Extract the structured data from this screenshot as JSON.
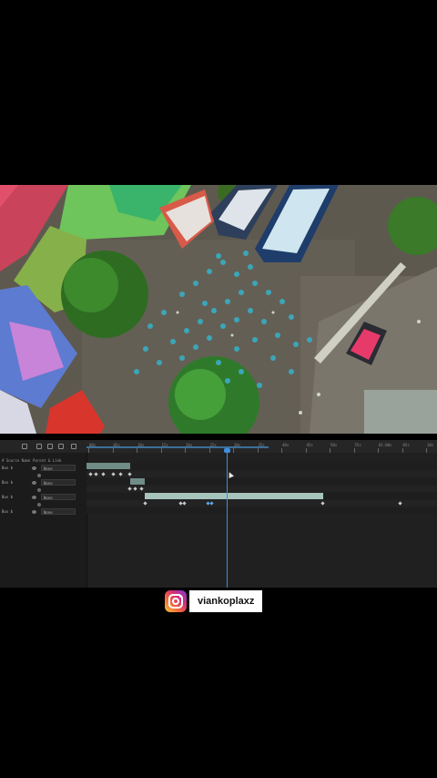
{
  "watermark": {
    "platform_icon": "instagram-icon",
    "handle": "viankoplaxz"
  },
  "timeline": {
    "ruler_labels": [
      "00s",
      "05s",
      "10s",
      "15s",
      "20s",
      "25s",
      "30s",
      "35s",
      "40s",
      "45s",
      "50s",
      "55s",
      "01:00s",
      "05s",
      "10s"
    ],
    "column_headers": {
      "layer_name": "# Source Name",
      "parent": "Parent & Link"
    },
    "layers": [
      {
        "name": "Bus b",
        "parent": "None"
      },
      {
        "name": "Bus b",
        "parent": "None"
      },
      {
        "name": "Bus b",
        "parent": "None"
      },
      {
        "name": "Bus b",
        "parent": "None"
      }
    ],
    "colors": {
      "playhead": "#3f8ee0",
      "clip": "#6f8c86",
      "clip_selected": "#a6c4bc"
    }
  }
}
